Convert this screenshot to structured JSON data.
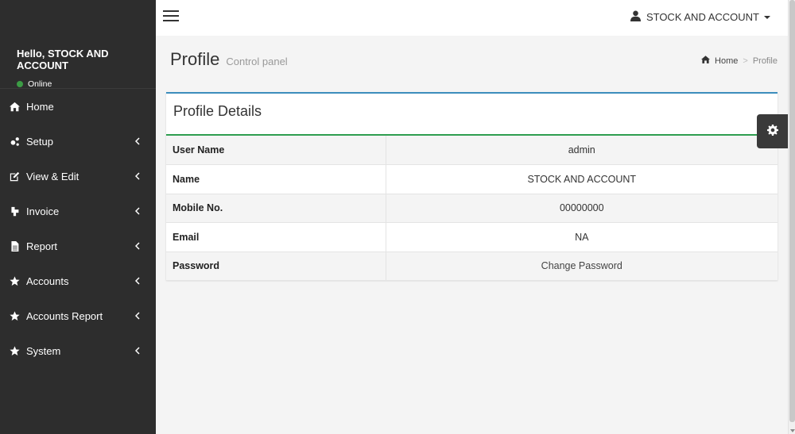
{
  "sidebar": {
    "greeting": "Hello, STOCK AND ACCOUNT",
    "status": "Online",
    "items": [
      {
        "label": "Home",
        "icon": "home-icon",
        "has_submenu": false
      },
      {
        "label": "Setup",
        "icon": "cogs-icon",
        "has_submenu": true
      },
      {
        "label": "View & Edit",
        "icon": "edit-icon",
        "has_submenu": true
      },
      {
        "label": "Invoice",
        "icon": "hand-icon",
        "has_submenu": true
      },
      {
        "label": "Report",
        "icon": "file-icon",
        "has_submenu": true
      },
      {
        "label": "Accounts",
        "icon": "star-icon",
        "has_submenu": true
      },
      {
        "label": "Accounts Report",
        "icon": "star-icon",
        "has_submenu": true
      },
      {
        "label": "System",
        "icon": "star-icon",
        "has_submenu": true
      }
    ]
  },
  "header": {
    "account_name": "STOCK AND ACCOUNT"
  },
  "page": {
    "title": "Profile",
    "subtitle": "Control panel",
    "breadcrumb": [
      "Home",
      "Profile"
    ]
  },
  "profile": {
    "box_title": "Profile Details",
    "rows": [
      {
        "label": "User Name",
        "value": "admin"
      },
      {
        "label": "Name",
        "value": "STOCK AND ACCOUNT"
      },
      {
        "label": "Mobile No.",
        "value": "00000000"
      },
      {
        "label": "Email",
        "value": "NA"
      },
      {
        "label": "Password",
        "value": "Change Password"
      }
    ]
  },
  "colors": {
    "sidebar_bg": "#2d2d2d",
    "status_online": "#3c9c45",
    "box_top_border": "#3c8dbc",
    "box_header_border": "#2e9e4f"
  }
}
